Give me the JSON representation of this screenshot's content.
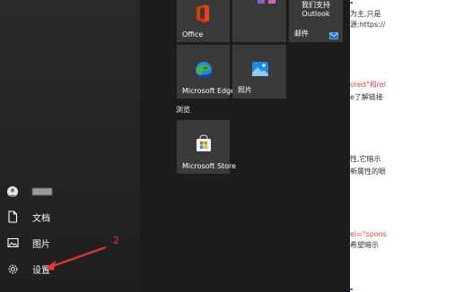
{
  "background_page": {
    "lines": [
      {
        "text": "为主,只是",
        "color": "#333333"
      },
      {
        "text": "源:https://",
        "color": "#333333"
      },
      {
        "text": "ored\"和rel",
        "color": "#e0453a"
      },
      {
        "text": "e了解链接",
        "color": "#333333"
      },
      {
        "text": "性,它暗示",
        "color": "#333333"
      },
      {
        "text": "新属性的眼",
        "color": "#333333"
      },
      {
        "text": "el=\"spons",
        "color": "#e0453a"
      },
      {
        "text": "希望暗示",
        "color": "#333333"
      }
    ]
  },
  "start_menu": {
    "user": {
      "icon": "user-avatar-icon",
      "name_redacted": true
    },
    "rail": [
      {
        "id": "documents",
        "label": "文档",
        "icon": "document-icon"
      },
      {
        "id": "pictures",
        "label": "图片",
        "icon": "pictures-icon"
      },
      {
        "id": "settings",
        "label": "设置",
        "icon": "gear-icon"
      }
    ],
    "tiles": {
      "office": {
        "label": "Office",
        "icon": "office-icon"
      },
      "mail": {
        "line1": "我们支持",
        "line2": "Outlook",
        "label": "邮件",
        "icon": "mail-icon"
      },
      "edge": {
        "label": "Microsoft Edge",
        "icon": "edge-icon"
      },
      "photos": {
        "label": "照片",
        "icon": "photos-icon"
      },
      "group_label": "浏览",
      "store": {
        "label": "Microsoft Store",
        "icon": "store-icon"
      }
    }
  },
  "annotation": {
    "number": "2",
    "color": "#e53935"
  }
}
